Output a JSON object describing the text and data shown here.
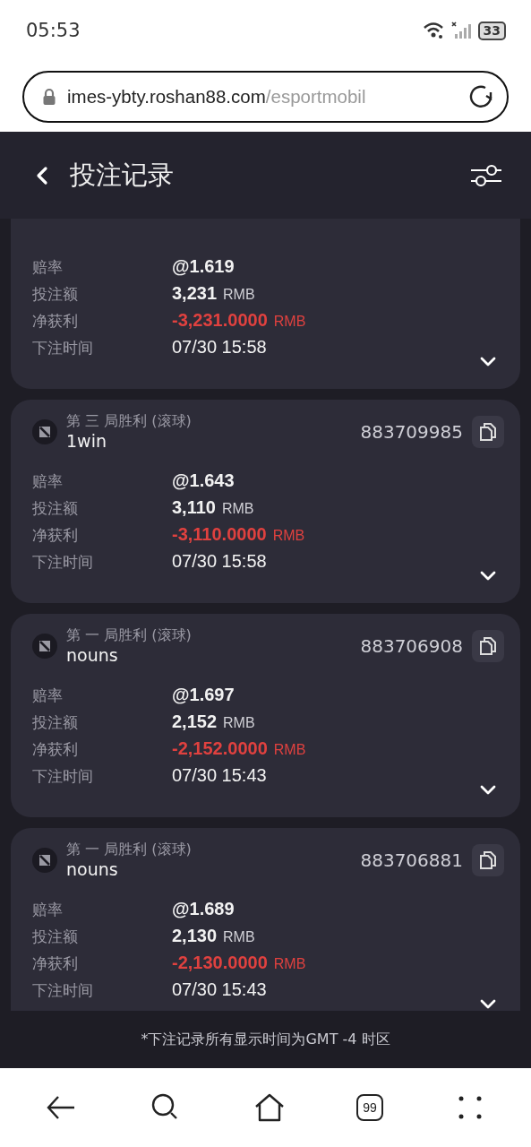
{
  "status_bar": {
    "time": "05:53",
    "battery": "33"
  },
  "address_bar": {
    "host": "imes-ybty.roshan88.com",
    "path": "/esportmobil"
  },
  "header": {
    "title": "投注记录"
  },
  "bets": [
    {
      "rows": [
        {
          "kind": "odds",
          "label": "赔率",
          "value": "@1.619"
        },
        {
          "kind": "stake",
          "label": "投注额",
          "value": "3,231",
          "unit": "RMB"
        },
        {
          "kind": "profit",
          "label": "净获利",
          "value": "-3,231.0000",
          "unit": "RMB"
        },
        {
          "kind": "time",
          "label": "下注时间",
          "value": "07/30 15:58"
        }
      ]
    },
    {
      "market": "第 三 局胜利 (滚球)",
      "team": "1win",
      "bet_id": "883709985",
      "rows": [
        {
          "kind": "odds",
          "label": "赔率",
          "value": "@1.643"
        },
        {
          "kind": "stake",
          "label": "投注额",
          "value": "3,110",
          "unit": "RMB"
        },
        {
          "kind": "profit",
          "label": "净获利",
          "value": "-3,110.0000",
          "unit": "RMB"
        },
        {
          "kind": "time",
          "label": "下注时间",
          "value": "07/30 15:58"
        }
      ]
    },
    {
      "market": "第 一 局胜利 (滚球)",
      "team": "nouns",
      "bet_id": "883706908",
      "rows": [
        {
          "kind": "odds",
          "label": "赔率",
          "value": "@1.697"
        },
        {
          "kind": "stake",
          "label": "投注额",
          "value": "2,152",
          "unit": "RMB"
        },
        {
          "kind": "profit",
          "label": "净获利",
          "value": "-2,152.0000",
          "unit": "RMB"
        },
        {
          "kind": "time",
          "label": "下注时间",
          "value": "07/30 15:43"
        }
      ]
    },
    {
      "market": "第 一 局胜利 (滚球)",
      "team": "nouns",
      "bet_id": "883706881",
      "rows": [
        {
          "kind": "odds",
          "label": "赔率",
          "value": "@1.689"
        },
        {
          "kind": "stake",
          "label": "投注额",
          "value": "2,130",
          "unit": "RMB"
        },
        {
          "kind": "profit",
          "label": "净获利",
          "value": "-2,130.0000",
          "unit": "RMB"
        },
        {
          "kind": "time",
          "label": "下注时间",
          "value": "07/30 15:43"
        }
      ]
    }
  ],
  "footer_note": "*下注记录所有显示时间为GMT -4 时区",
  "nav": {
    "tabs_count": "99"
  }
}
